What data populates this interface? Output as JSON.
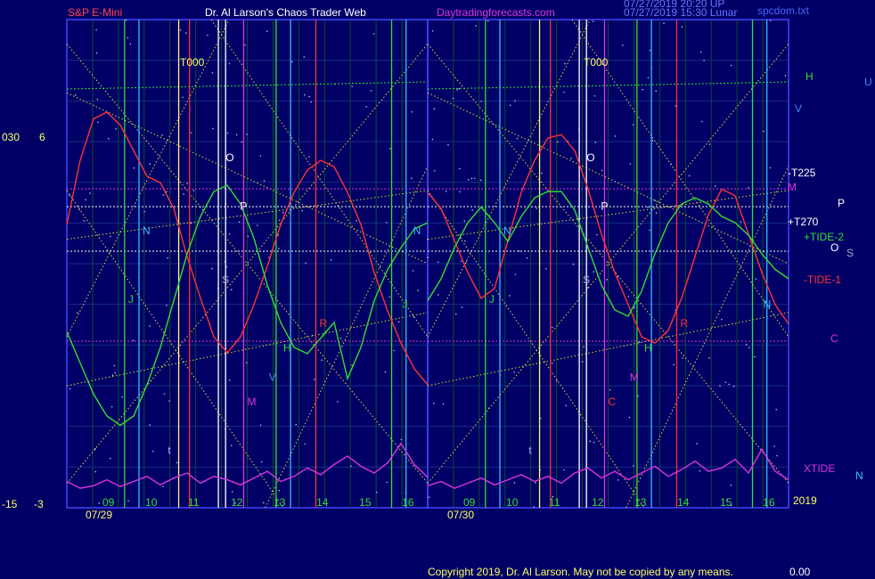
{
  "header": {
    "left": "S&P E-Mini",
    "center": "Dr. Al Larson's Chaos Trader Web",
    "site": "Daytradingforecasts.com",
    "stamp1": "07/27/2019 20:20 UP",
    "stamp2": "07/27/2019 15:30 Lunar",
    "file": "spcdom.txt"
  },
  "footer": {
    "copyright": "Copyright 2019, Dr. Al Larson. May not be copied by any means.",
    "corner": "0.00"
  },
  "colors": {
    "bg": "#000066",
    "tide1": "#ff3333",
    "tide2": "#33dd33",
    "xtide": "#dd33dd",
    "yellowDots": "#dddd33",
    "panelBorder": "#4444ff"
  },
  "chart_data": {
    "type": "line",
    "left_scale": [
      "030",
      "6",
      "-15",
      "-3"
    ],
    "year_label": "2019",
    "panels": [
      {
        "date": "07/29",
        "hours": [
          "09",
          "10",
          "11",
          "12",
          "13",
          "14",
          "15",
          "16"
        ],
        "t000": "T000",
        "letters": [
          "J",
          "N",
          "t",
          "O",
          "P",
          "S",
          "M",
          "V",
          "H",
          "R",
          "J",
          "N"
        ],
        "series": [
          {
            "name": "-TIDE-1",
            "values": [
              0.55,
              0.75,
              0.88,
              0.9,
              0.86,
              0.78,
              0.7,
              0.68,
              0.6,
              0.45,
              0.32,
              0.2,
              0.15,
              0.2,
              0.3,
              0.42,
              0.55,
              0.65,
              0.72,
              0.75,
              0.73,
              0.65,
              0.55,
              0.4,
              0.28,
              0.18,
              0.1,
              0.05
            ]
          },
          {
            "name": "+TIDE-2",
            "values": [
              0.35,
              0.25,
              0.15,
              0.08,
              0.05,
              0.08,
              0.18,
              0.3,
              0.45,
              0.6,
              0.72,
              0.8,
              0.82,
              0.76,
              0.65,
              0.5,
              0.38,
              0.3,
              0.28,
              0.33,
              0.38,
              0.2,
              0.3,
              0.45,
              0.55,
              0.62,
              0.68,
              0.7
            ]
          },
          {
            "name": "XTIDE",
            "values": [
              0.1,
              0.02,
              0.05,
              0.12,
              0.04,
              0.1,
              0.16,
              0.06,
              0.14,
              0.2,
              0.08,
              0.16,
              0.12,
              0.06,
              0.14,
              0.22,
              0.1,
              0.16,
              0.26,
              0.18,
              0.3,
              0.4,
              0.28,
              0.2,
              0.32,
              0.55,
              0.3,
              0.15
            ]
          }
        ]
      },
      {
        "date": "07/30",
        "hours": [
          "09",
          "10",
          "11",
          "12",
          "13",
          "14",
          "15",
          "16"
        ],
        "t000": "T000",
        "letters": [
          "J",
          "N",
          "t",
          "O",
          "P",
          "S",
          "C",
          "M",
          "H",
          "R",
          "N"
        ],
        "series": [
          {
            "name": "-TIDE-1",
            "values": [
              0.65,
              0.6,
              0.5,
              0.4,
              0.32,
              0.35,
              0.5,
              0.65,
              0.75,
              0.82,
              0.83,
              0.78,
              0.66,
              0.52,
              0.4,
              0.3,
              0.2,
              0.18,
              0.22,
              0.32,
              0.45,
              0.58,
              0.66,
              0.64,
              0.52,
              0.4,
              0.3,
              0.24
            ]
          },
          {
            "name": "+TIDE-2",
            "values": [
              0.45,
              0.52,
              0.62,
              0.7,
              0.75,
              0.7,
              0.64,
              0.72,
              0.78,
              0.8,
              0.8,
              0.74,
              0.62,
              0.5,
              0.42,
              0.4,
              0.48,
              0.6,
              0.7,
              0.76,
              0.78,
              0.76,
              0.72,
              0.7,
              0.66,
              0.6,
              0.55,
              0.52
            ]
          },
          {
            "name": "XTIDE",
            "values": [
              0.05,
              0.1,
              0.02,
              0.08,
              0.14,
              0.06,
              0.12,
              0.18,
              0.1,
              0.16,
              0.08,
              0.2,
              0.26,
              0.14,
              0.22,
              0.12,
              0.2,
              0.28,
              0.16,
              0.24,
              0.34,
              0.22,
              0.26,
              0.36,
              0.2,
              0.48,
              0.22,
              0.12
            ]
          }
        ]
      }
    ],
    "right_labels": [
      {
        "text": "H",
        "color": "#33dd33"
      },
      {
        "text": "U",
        "color": "#4488ff"
      },
      {
        "text": "V",
        "color": "#4488ff"
      },
      {
        "text": "-T225",
        "color": "#ffffff"
      },
      {
        "text": "M",
        "color": "#dd33dd"
      },
      {
        "text": "P",
        "color": "#ffffff"
      },
      {
        "text": "+T270",
        "color": "#ffffff"
      },
      {
        "text": "+TIDE-2",
        "color": "#33dd33"
      },
      {
        "text": "O",
        "color": "#ffffff"
      },
      {
        "text": "S",
        "color": "#aaaacc"
      },
      {
        "text": "-TIDE-1",
        "color": "#ff3333"
      },
      {
        "text": "C",
        "color": "#dd33dd"
      },
      {
        "text": "XTIDE",
        "color": "#dd33dd"
      },
      {
        "text": "N",
        "color": "#33bbff"
      }
    ]
  }
}
